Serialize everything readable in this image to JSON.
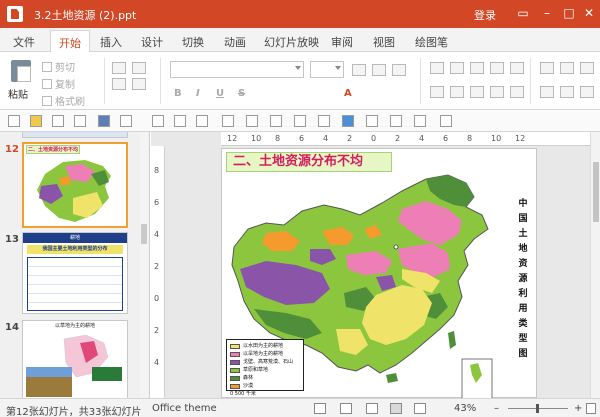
{
  "window": {
    "title": "3.2土地资源 (2).ppt",
    "login": "登录",
    "brand_color": "#d24726"
  },
  "tabs": [
    {
      "label": "文件",
      "active": false
    },
    {
      "label": "开始",
      "active": true
    },
    {
      "label": "插入",
      "active": false
    },
    {
      "label": "设计",
      "active": false
    },
    {
      "label": "切换",
      "active": false
    },
    {
      "label": "动画",
      "active": false
    },
    {
      "label": "幻灯片放映",
      "active": false
    },
    {
      "label": "审阅",
      "active": false
    },
    {
      "label": "视图",
      "active": false
    },
    {
      "label": "绘图笔",
      "active": false
    }
  ],
  "ribbon": {
    "paste": "粘贴",
    "cut": "剪切",
    "copy": "复制",
    "format_painter": "格式刷",
    "bold": "B",
    "italic": "I",
    "underline": "U",
    "strike": "S",
    "font_color": "A",
    "font_value": "",
    "size_value": ""
  },
  "slides_panel": {
    "thumbs": [
      {
        "number": "12",
        "title": "二、土地资源分布不均",
        "active": true
      },
      {
        "number": "13",
        "title": "耕地",
        "subtitle": "我国主要土地利用类型的分布"
      },
      {
        "number": "14",
        "title": "以草地为主的耕地"
      }
    ]
  },
  "ruler": {
    "h": [
      "12",
      "10",
      "8",
      "6",
      "4",
      "2",
      "0",
      "2",
      "4",
      "6",
      "8",
      "10",
      "12"
    ],
    "v": [
      "8",
      "6",
      "4",
      "2",
      "0",
      "2",
      "4"
    ]
  },
  "slide": {
    "title": "二、土地资源分布不均",
    "vertical_title": [
      "中",
      "国",
      "土",
      "地",
      "资",
      "源",
      "利",
      "用",
      "类",
      "型",
      "图"
    ],
    "legend": [
      {
        "label": "以水田为主的耕地",
        "color": "#f0e36a"
      },
      {
        "label": "以旱地为主的耕地",
        "color": "#ee7fb6"
      },
      {
        "label": "戈壁、高寒荒漠、石山",
        "color": "#8a55a8"
      },
      {
        "label": "草原和草地",
        "color": "#8cc63f"
      },
      {
        "label": "森林",
        "color": "#4f8f3a"
      },
      {
        "label": "沙漠",
        "color": "#f59a2c"
      }
    ],
    "scale": "0    500 千米"
  },
  "status": {
    "slide_info": "第12张幻灯片，共33张幻灯片",
    "theme": "Office theme",
    "zoom": "43%"
  }
}
